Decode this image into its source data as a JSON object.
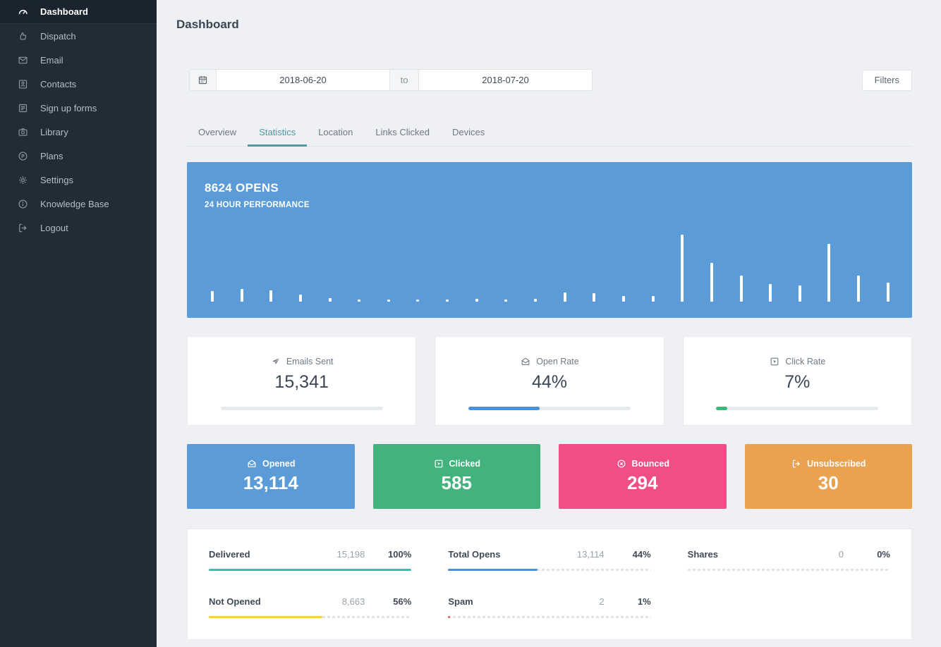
{
  "header": {
    "title": "Dashboard"
  },
  "sidebar": {
    "items": [
      {
        "icon": "dashboard-icon",
        "label": "Dashboard",
        "active": true
      },
      {
        "icon": "dispatch-icon",
        "label": "Dispatch"
      },
      {
        "icon": "email-icon",
        "label": "Email"
      },
      {
        "icon": "contacts-icon",
        "label": "Contacts"
      },
      {
        "icon": "signup-forms-icon",
        "label": "Sign up forms"
      },
      {
        "icon": "library-icon",
        "label": "Library"
      },
      {
        "icon": "plans-icon",
        "label": "Plans"
      },
      {
        "icon": "settings-icon",
        "label": "Settings"
      },
      {
        "icon": "knowledge-base-icon",
        "label": "Knowledge Base"
      },
      {
        "icon": "logout-icon",
        "label": "Logout"
      }
    ]
  },
  "date_range": {
    "from": "2018-06-20",
    "separator": "to",
    "to": "2018-07-20"
  },
  "filters_button": {
    "label": "Filters"
  },
  "tabs": [
    {
      "label": "Overview"
    },
    {
      "label": "Statistics",
      "active": true
    },
    {
      "label": "Location"
    },
    {
      "label": "Links Clicked"
    },
    {
      "label": "Devices"
    }
  ],
  "chart_data": {
    "type": "bar",
    "title": "8624 OPENS",
    "subtitle": "24 HOUR PERFORMANCE",
    "panel_color": "#5b9bd8",
    "bar_color": "#ffffff",
    "ylabel": "opens per hour (relative height %, no axis labels shown)",
    "values": [
      16,
      19,
      17,
      11,
      5,
      3,
      3,
      3,
      3,
      4,
      3,
      4,
      14,
      13,
      8,
      8,
      100,
      58,
      39,
      26,
      24,
      86,
      39,
      28
    ]
  },
  "stat_cards": [
    {
      "icon": "send-icon",
      "label": "Emails Sent",
      "value": "15,341",
      "pct": 0,
      "color": "#e7eaed"
    },
    {
      "icon": "open-rate-icon",
      "label": "Open Rate",
      "value": "44%",
      "pct": 44,
      "color": "#4a90d9"
    },
    {
      "icon": "click-rate-icon",
      "label": "Click Rate",
      "value": "7%",
      "pct": 7,
      "color": "#3cb878"
    }
  ],
  "metric_cards": [
    {
      "icon": "opened-icon",
      "label": "Opened",
      "value": "13,114",
      "color": "#5b9bd8"
    },
    {
      "icon": "clicked-icon",
      "label": "Clicked",
      "value": "585",
      "color": "#42b37d"
    },
    {
      "icon": "bounced-icon",
      "label": "Bounced",
      "value": "294",
      "color": "#ef4e87"
    },
    {
      "icon": "unsubscribed-icon",
      "label": "Unsubscribed",
      "value": "30",
      "color": "#eba24e"
    }
  ],
  "breakdown": {
    "rows": [
      {
        "label": "Delivered",
        "value": "15,198",
        "pct_label": "100%",
        "pct": 100,
        "color": "#35c0b2"
      },
      {
        "label": "Total Opens",
        "value": "13,114",
        "pct_label": "44%",
        "pct": 44,
        "color": "#4a90d9"
      },
      {
        "label": "Shares",
        "value": "0",
        "pct_label": "0%",
        "pct": 0,
        "color": "transparent"
      },
      {
        "label": "Not Opened",
        "value": "8,663",
        "pct_label": "56%",
        "pct": 56,
        "color": "#fbd045"
      },
      {
        "label": "Spam",
        "value": "2",
        "pct_label": "1%",
        "pct": 1,
        "color": "#e05c5c"
      }
    ]
  },
  "colors": {
    "sidebar_bg": "#212c37",
    "page_bg": "#eef0f3",
    "tab_accent": "#4b9aa0",
    "chart_blue": "#5b9bd8"
  }
}
